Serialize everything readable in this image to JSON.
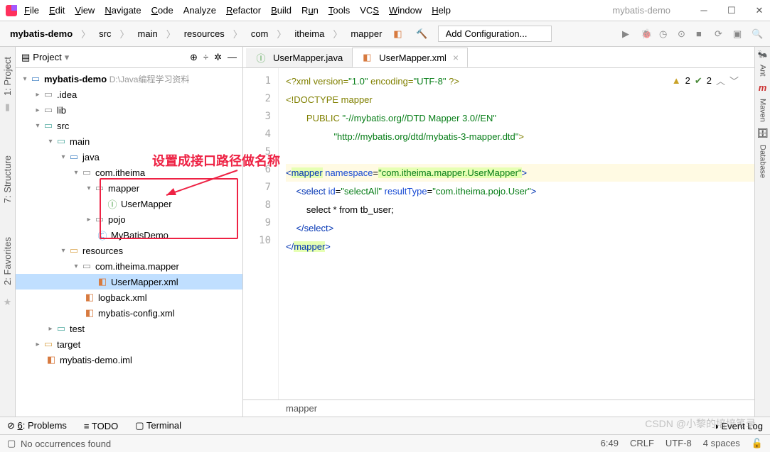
{
  "menu": {
    "file": "File",
    "edit": "Edit",
    "view": "View",
    "navigate": "Navigate",
    "code": "Code",
    "analyze": "Analyze",
    "refactor": "Refactor",
    "build": "Build",
    "run": "Run",
    "tools": "Tools",
    "vcs": "VCS",
    "window": "Window",
    "help": "Help"
  },
  "window_title": "mybatis-demo",
  "breadcrumbs": [
    "mybatis-demo",
    "src",
    "main",
    "resources",
    "com",
    "itheima",
    "mapper"
  ],
  "run_config_placeholder": "Add Configuration...",
  "project_panel": {
    "title": "Project"
  },
  "tree": {
    "root": {
      "name": "mybatis-demo",
      "path": "D:\\Java编程学习资料"
    },
    "idea": ".idea",
    "lib": "lib",
    "src": "src",
    "main": "main",
    "java": "java",
    "pkg": "com.itheima",
    "mapper": "mapper",
    "usermapper_cls": "UserMapper",
    "pojo": "pojo",
    "mybatisdemo": "MyBatisDemo",
    "resources": "resources",
    "res_pkg": "com.itheima.mapper",
    "usermapper_xml": "UserMapper.xml",
    "logback": "logback.xml",
    "mybatis_cfg": "mybatis-config.xml",
    "test": "test",
    "target": "target",
    "iml": "mybatis-demo.iml"
  },
  "annotation": "设置成接口路径做名称",
  "tabs": {
    "java": "UserMapper.java",
    "xml": "UserMapper.xml"
  },
  "code": {
    "l1a": "<?",
    "l1b": "xml version=",
    "l1c": "\"1.0\"",
    "l1d": " encoding=",
    "l1e": "\"UTF-8\"",
    "l1f": " ?>",
    "l2": "<!DOCTYPE mapper",
    "l3a": "        PUBLIC ",
    "l3b": "\"-//mybatis.org//DTD Mapper 3.0//EN\"",
    "l4": "\"http://mybatis.org/dtd/mybatis-3-mapper.dtd\"",
    "l4b": ">",
    "l6a": "<",
    "l6tag": "mapper",
    "l6sp": " ",
    "l6attr": "namespace",
    "l6eq": "=",
    "l6val": "\"com.itheima.mapper.UserMapper\"",
    "l6end": ">",
    "l7a": "    <",
    "l7tag": "select",
    "l7sp": " ",
    "l7id": "id",
    "l7eq": "=",
    "l7idv": "\"selectAll\"",
    "l7sp2": " ",
    "l7rt": "resultType",
    "l7eq2": "=",
    "l7rtv": "\"com.itheima.pojo.User\"",
    "l7end": ">",
    "l8": "        select * from tb_user;",
    "l9": "    </",
    "l9tag": "select",
    "l9end": ">",
    "l10": "</",
    "l10tag": "mapper",
    "l10end": ">"
  },
  "badges": {
    "warn": "2",
    "ok": "2"
  },
  "crumb_editor": "mapper",
  "left_tabs": {
    "project": "1: Project",
    "structure": "7: Structure",
    "favorites": "2: Favorites"
  },
  "right_tabs": {
    "ant": "Ant",
    "maven": "Maven",
    "db": "Database"
  },
  "bottom": {
    "problems": "6: Problems",
    "todo": "TODO",
    "terminal": "Terminal",
    "eventlog": "Event Log"
  },
  "status": {
    "msg": "No occurrences found",
    "pos": "6:49",
    "le": "CRLF",
    "enc": "UTF-8",
    "indent": "4 spaces"
  },
  "watermark": "CSDN @小黎的培培笔录"
}
